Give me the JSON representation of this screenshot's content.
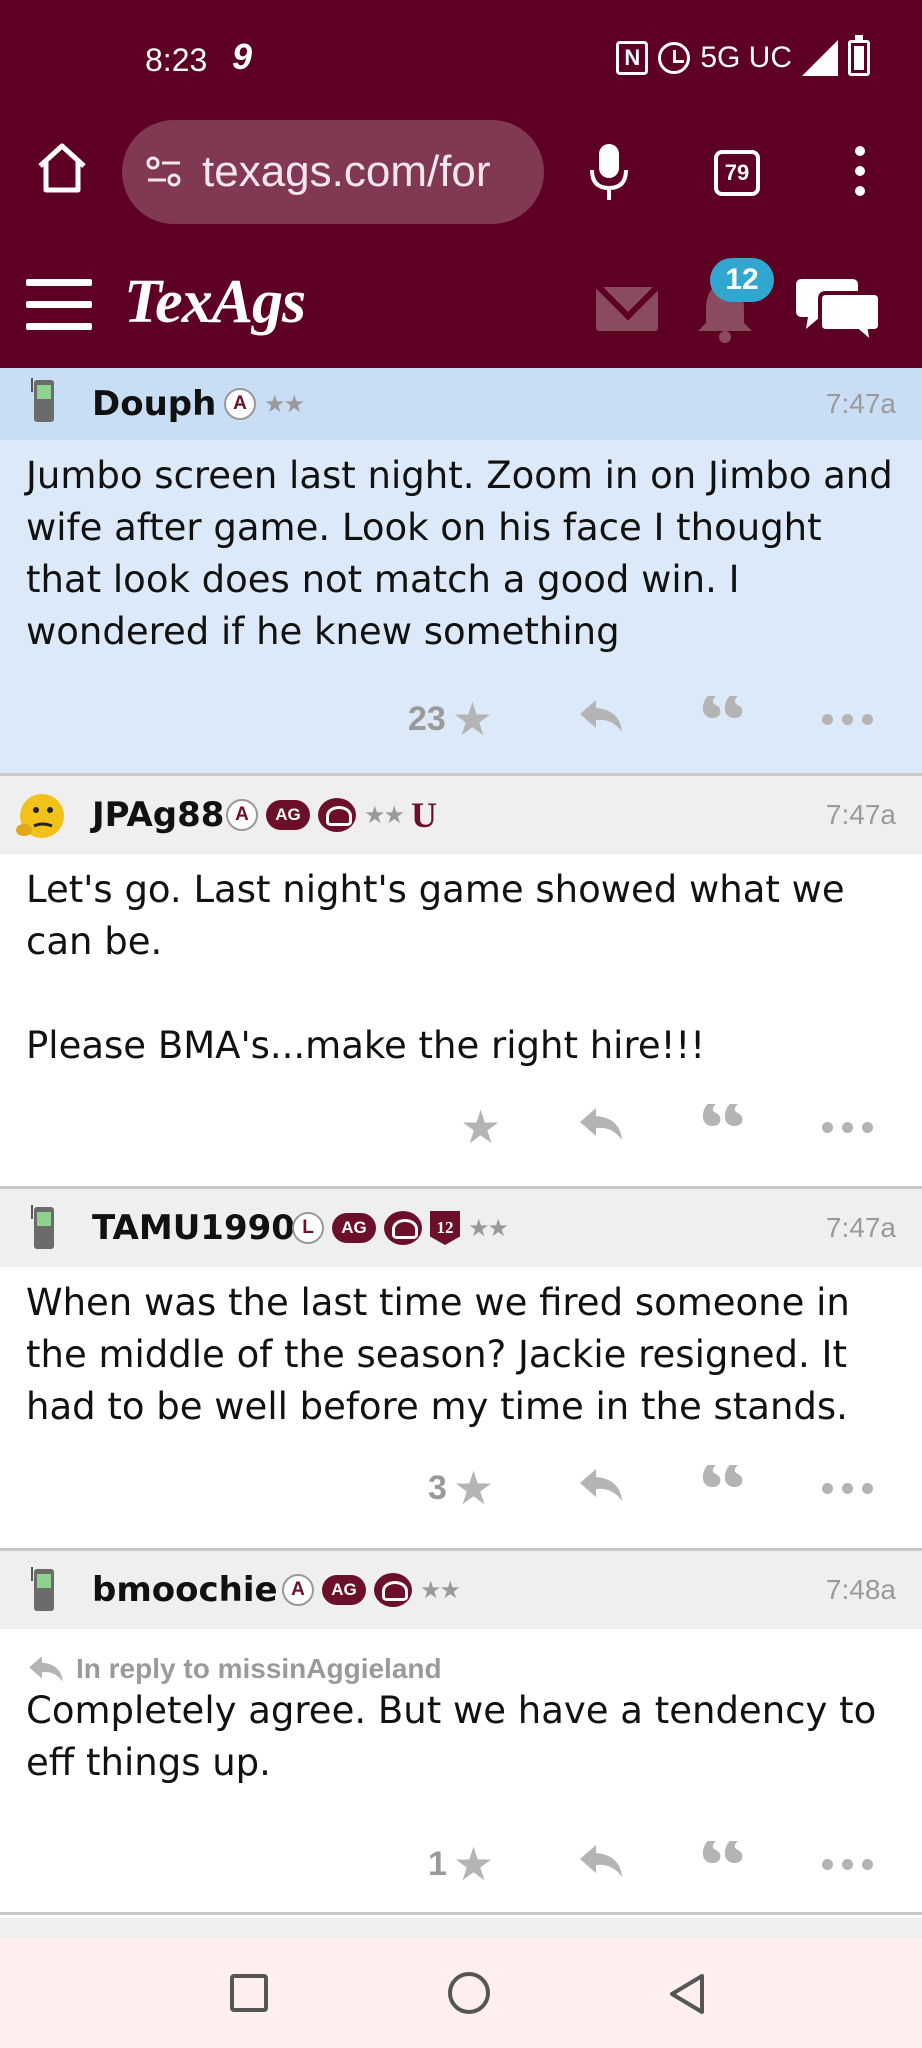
{
  "status_bar": {
    "time": "8:23",
    "carrier_icon": "9",
    "network": "5G UC",
    "icons": [
      "nfc-icon",
      "alarm-icon",
      "signal-icon",
      "battery-charging-icon"
    ]
  },
  "browser": {
    "url": "texags.com/for",
    "tab_count": "79",
    "icons": [
      "home-icon",
      "site-info-icon",
      "mic-icon",
      "tabs-icon",
      "menu-icon"
    ]
  },
  "site_header": {
    "logo": "TexAgs",
    "notifications_count": "12",
    "icons": [
      "hamburger-icon",
      "mail-icon",
      "bell-icon",
      "chat-icon"
    ]
  },
  "posts": [
    {
      "username": "Douph",
      "badges": [
        "A"
      ],
      "stars": "★★",
      "time": "7:47a",
      "body": [
        "Jumbo screen last night. Zoom in on Jimbo and wife after game. Look on his face I thought that look does not match a good win. I wondered if he knew something"
      ],
      "likes": "23",
      "highlighted": true
    },
    {
      "username": "JPAg88",
      "badges": [
        "A",
        "AG",
        "helmet",
        "U"
      ],
      "stars": "★★",
      "time": "7:47a",
      "body": [
        "Let's go. Last night's game showed what we can be.",
        "Please BMA's...make the right hire!!!"
      ],
      "likes": ""
    },
    {
      "username": "TAMU1990",
      "badges": [
        "L",
        "AG",
        "helmet",
        "12"
      ],
      "stars": "★★",
      "time": "7:47a",
      "body": [
        "When was the last time we fired someone in the middle of the season? Jackie resigned. It had to be well before my time in the stands."
      ],
      "likes": "3"
    },
    {
      "username": "bmoochie",
      "badges": [
        "A",
        "AG",
        "helmet"
      ],
      "stars": "★★",
      "time": "7:48a",
      "reply_to": "In reply to missinAggieland",
      "body": [
        "Completely agree. But we have a tendency to eff things up."
      ],
      "likes": "1"
    }
  ],
  "colors": {
    "maroon": "#5e0023",
    "badge_blue": "#31a6cf",
    "highlight_bg": "#dce9f8",
    "header_bg": "#efefef"
  }
}
